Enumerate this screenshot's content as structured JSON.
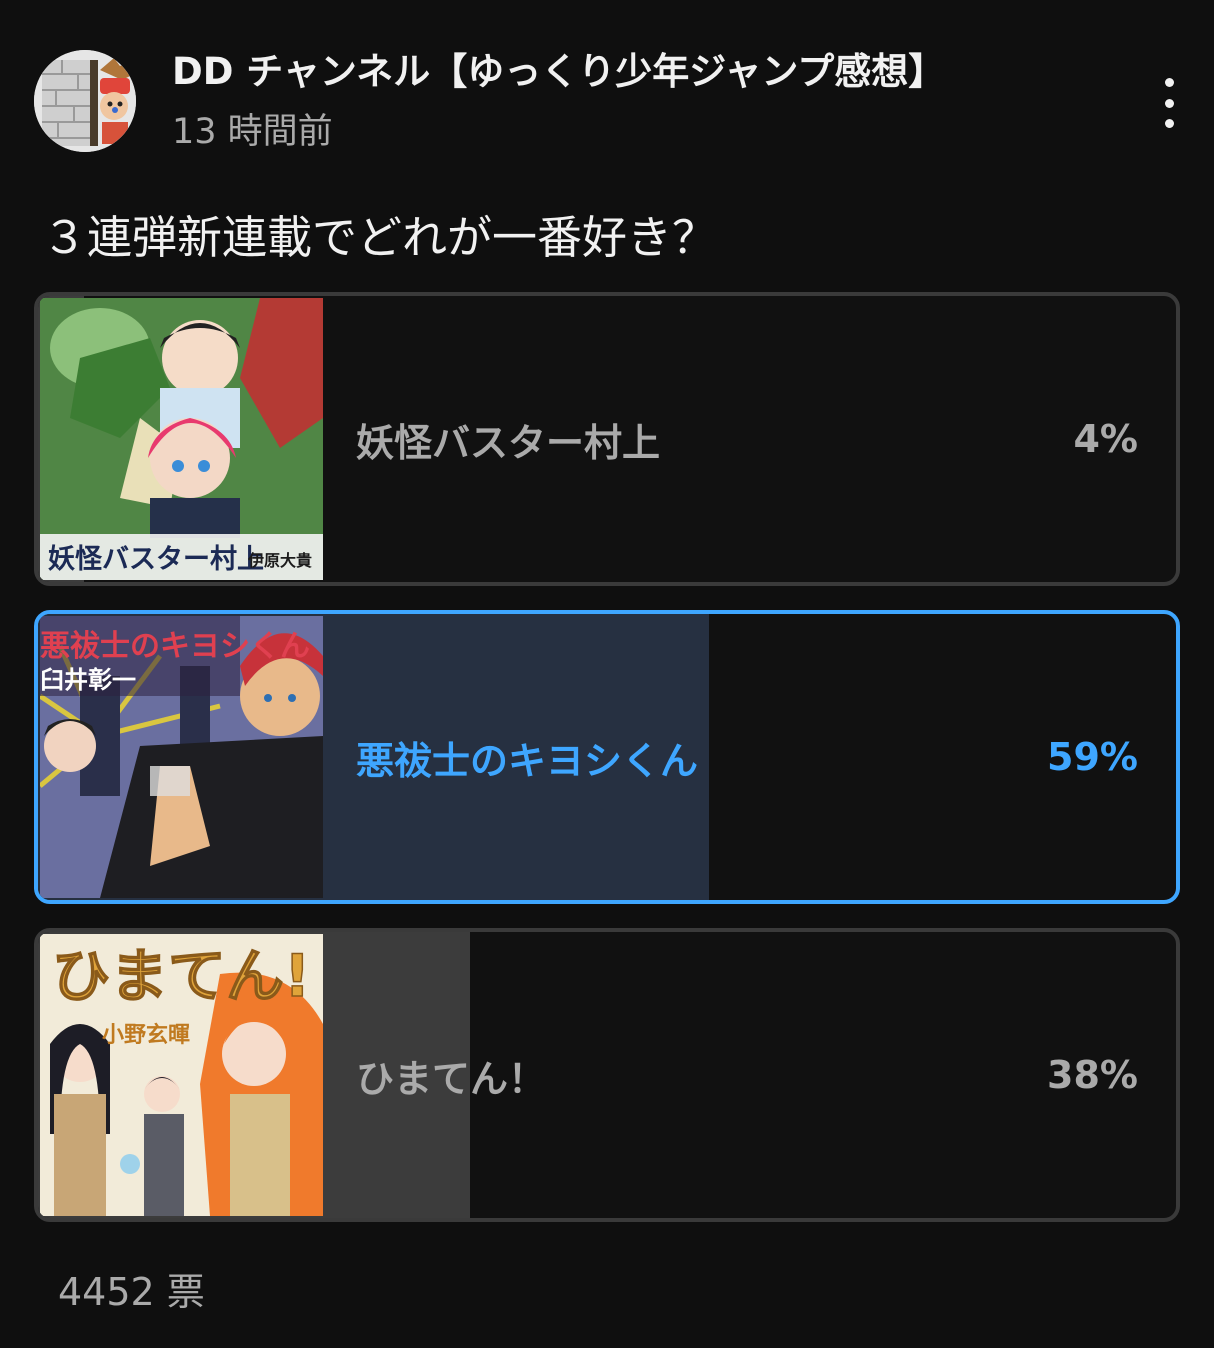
{
  "post": {
    "channel_name": "DD チャンネル【ゆっくり少年ジャンプ感想】",
    "timestamp": "13 時間前",
    "menu_icon": "more-vert-icon"
  },
  "poll": {
    "question": "３連弾新連載でどれが一番好き？",
    "options": [
      {
        "label": "妖怪バスター村上",
        "percent_text": "4%",
        "percent": 4,
        "selected": false,
        "thumbnail": {
          "title_text": "妖怪バスター村上",
          "author_text": "伊原大貴"
        }
      },
      {
        "label": "悪祓士のキヨシくん",
        "percent_text": "59%",
        "percent": 59,
        "selected": true,
        "thumbnail": {
          "title_text": "悪祓士のキヨシくん",
          "author_text": "臼井彰一"
        }
      },
      {
        "label": "ひまてん！",
        "percent_text": "38%",
        "percent": 38,
        "selected": false,
        "thumbnail": {
          "title_text": "ひまてん!",
          "author_text": "小野玄暉"
        }
      }
    ],
    "total_votes": "4452 票"
  },
  "colors": {
    "background": "#0f0f0f",
    "selected_accent": "#3ea6ff",
    "bar_normal": "#3c3c3c",
    "bar_selected": "#263041",
    "text_muted": "#aaaaaa"
  }
}
